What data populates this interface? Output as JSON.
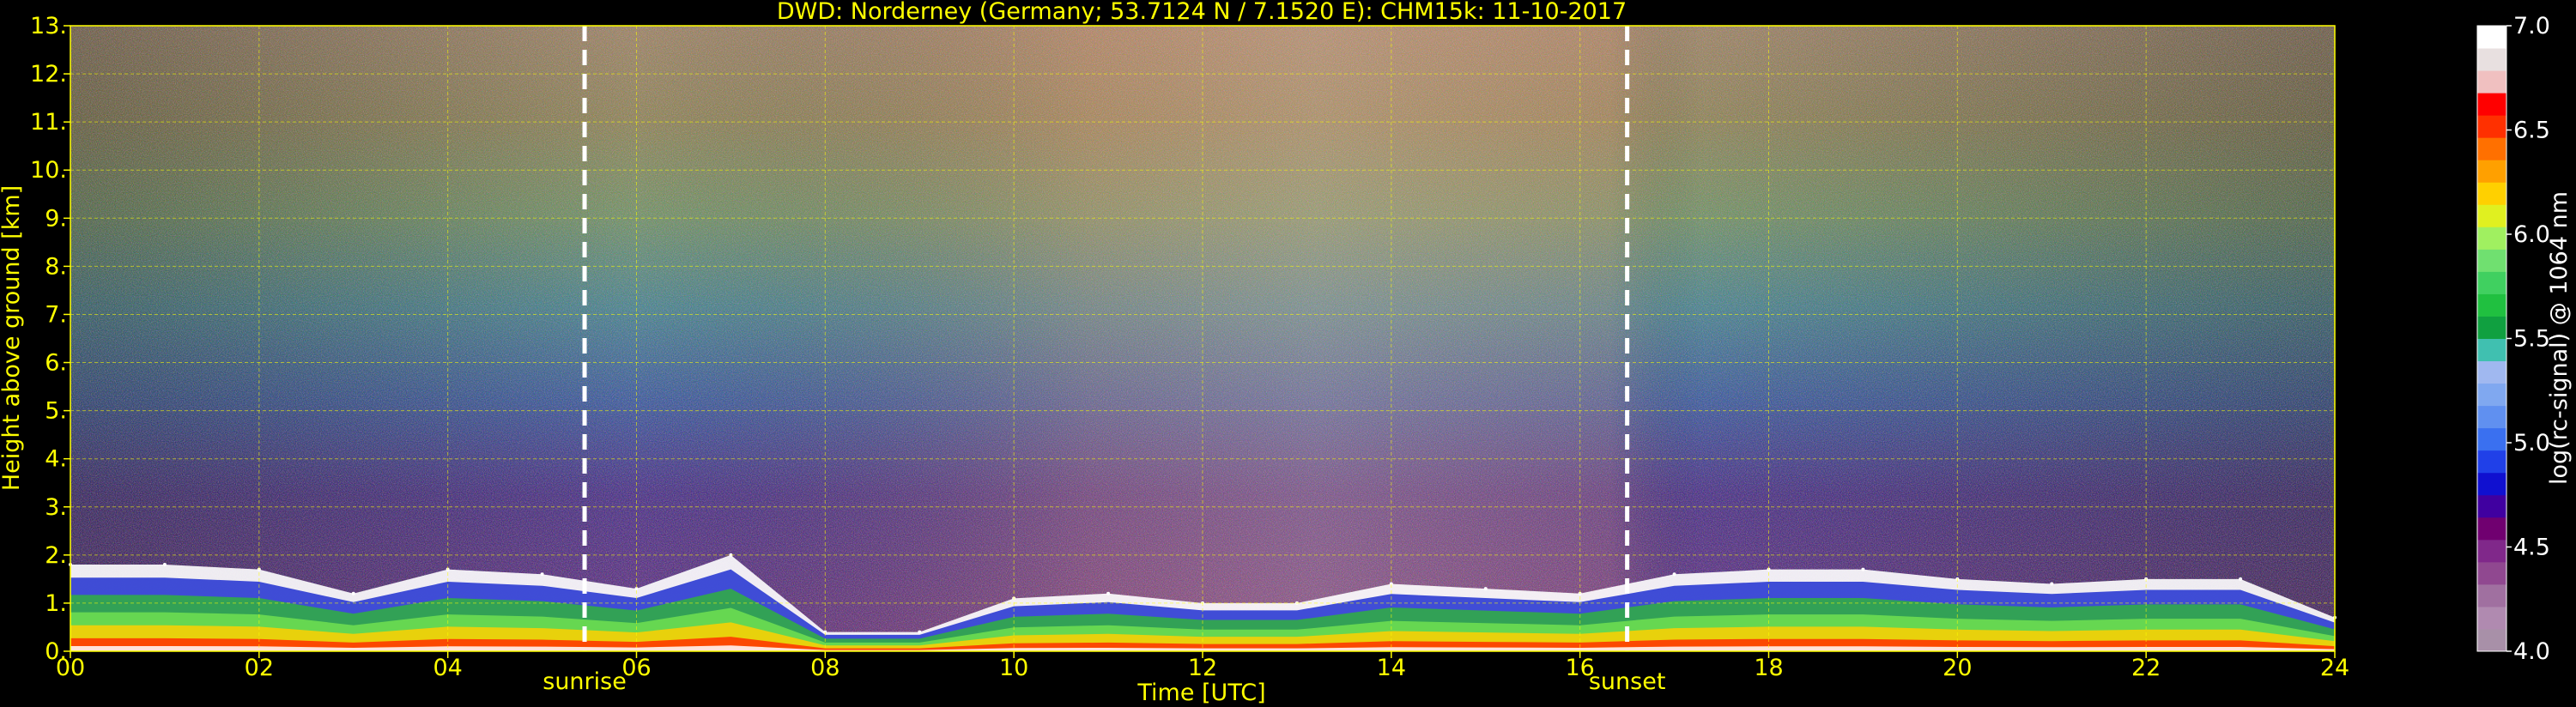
{
  "chart_data": {
    "type": "heatmap",
    "title": "DWD: Norderney (Germany; 53.7124 N / 7.1520 E):    CHM15k: 11-10-2017",
    "xlabel": "Time [UTC]",
    "ylabel": "Height above ground [km]",
    "xlim": [
      0,
      24
    ],
    "ylim": [
      0,
      13
    ],
    "x_ticks": [
      "00",
      "02",
      "04",
      "06",
      "08",
      "10",
      "12",
      "14",
      "16",
      "18",
      "20",
      "22",
      "24"
    ],
    "y_ticks": [
      "0.",
      "1.",
      "2.",
      "3.",
      "4.",
      "5.",
      "6.",
      "7.",
      "8.",
      "9.",
      "10.",
      "11.",
      "12.",
      "13."
    ],
    "grid": true,
    "markers": [
      {
        "label": "sunrise",
        "time": 5.45
      },
      {
        "label": "sunset",
        "time": 16.5
      }
    ],
    "colorbar": {
      "label": "log(rc-signal) @ 1064 nm",
      "range": [
        4.0,
        7.0
      ],
      "ticks": [
        "4.0",
        "4.5",
        "5.0",
        "5.5",
        "6.0",
        "6.5",
        "7.0"
      ],
      "colors": [
        "#a890a8",
        "#b08ab0",
        "#a070a0",
        "#904890",
        "#80288a",
        "#700070",
        "#4000a0",
        "#1010d0",
        "#2040e8",
        "#3a70f0",
        "#6090f0",
        "#80a8f0",
        "#a0b8f0",
        "#40c0b0",
        "#10a040",
        "#20c040",
        "#40d060",
        "#70e070",
        "#a0f060",
        "#e0f020",
        "#ffd000",
        "#ffa000",
        "#ff7000",
        "#ff3000",
        "#ff0000",
        "#f0c0c0",
        "#e8e0e0",
        "#ffffff"
      ]
    },
    "cloud_base_series": {
      "name": "",
      "x": [
        0,
        1,
        2,
        3,
        4,
        5,
        6,
        7,
        8,
        9,
        10,
        11,
        12,
        13,
        14,
        15,
        16,
        17,
        18,
        19,
        20,
        21,
        22,
        23,
        24
      ],
      "y": [
        1.8,
        1.8,
        1.7,
        1.2,
        1.7,
        1.6,
        1.3,
        2.0,
        0.4,
        0.4,
        1.1,
        1.2,
        1.0,
        1.0,
        1.4,
        1.3,
        1.2,
        1.6,
        1.7,
        1.7,
        1.5,
        1.4,
        1.5,
        1.5,
        0.7
      ]
    }
  }
}
